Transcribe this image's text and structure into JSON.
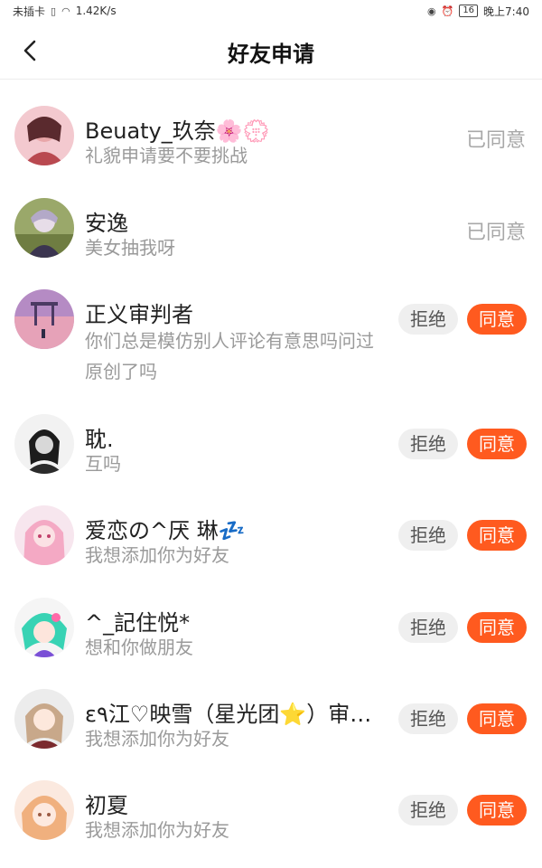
{
  "status_bar": {
    "carrier": "未插卡",
    "speed": "1.42K/s",
    "battery": "16",
    "time": "晚上7:40"
  },
  "header": {
    "title": "好友申请"
  },
  "requests": [
    {
      "name": "Beuaty_玖奈🌸💮",
      "message": "礼貌申请要不要挑战",
      "status": "已同意"
    },
    {
      "name": "安逸",
      "message": "美女抽我呀",
      "status": "已同意"
    },
    {
      "name": "正义审判者",
      "message": "你们总是模仿别人评论有意思吗问过原创了吗",
      "reject": "拒绝",
      "accept": "同意"
    },
    {
      "name": "耽.",
      "message": "互吗",
      "reject": "拒绝",
      "accept": "同意"
    },
    {
      "name": "爱恋の^厌 琳💤",
      "message": "我想添加你为好友",
      "reject": "拒绝",
      "accept": "同意"
    },
    {
      "name": "^_記住悦*",
      "message": "想和你做朋友",
      "reject": "拒绝",
      "accept": "同意"
    },
    {
      "name": "ε٩江♡映雪（星光团⭐）审…",
      "message": "我想添加你为好友",
      "reject": "拒绝",
      "accept": "同意"
    },
    {
      "name": "初夏",
      "message": "我想添加你为好友",
      "reject": "拒绝",
      "accept": "同意"
    }
  ],
  "colors": {
    "accent": "#ff5a1f",
    "reject_bg": "#efefef",
    "muted_text": "#9a9a9a"
  }
}
